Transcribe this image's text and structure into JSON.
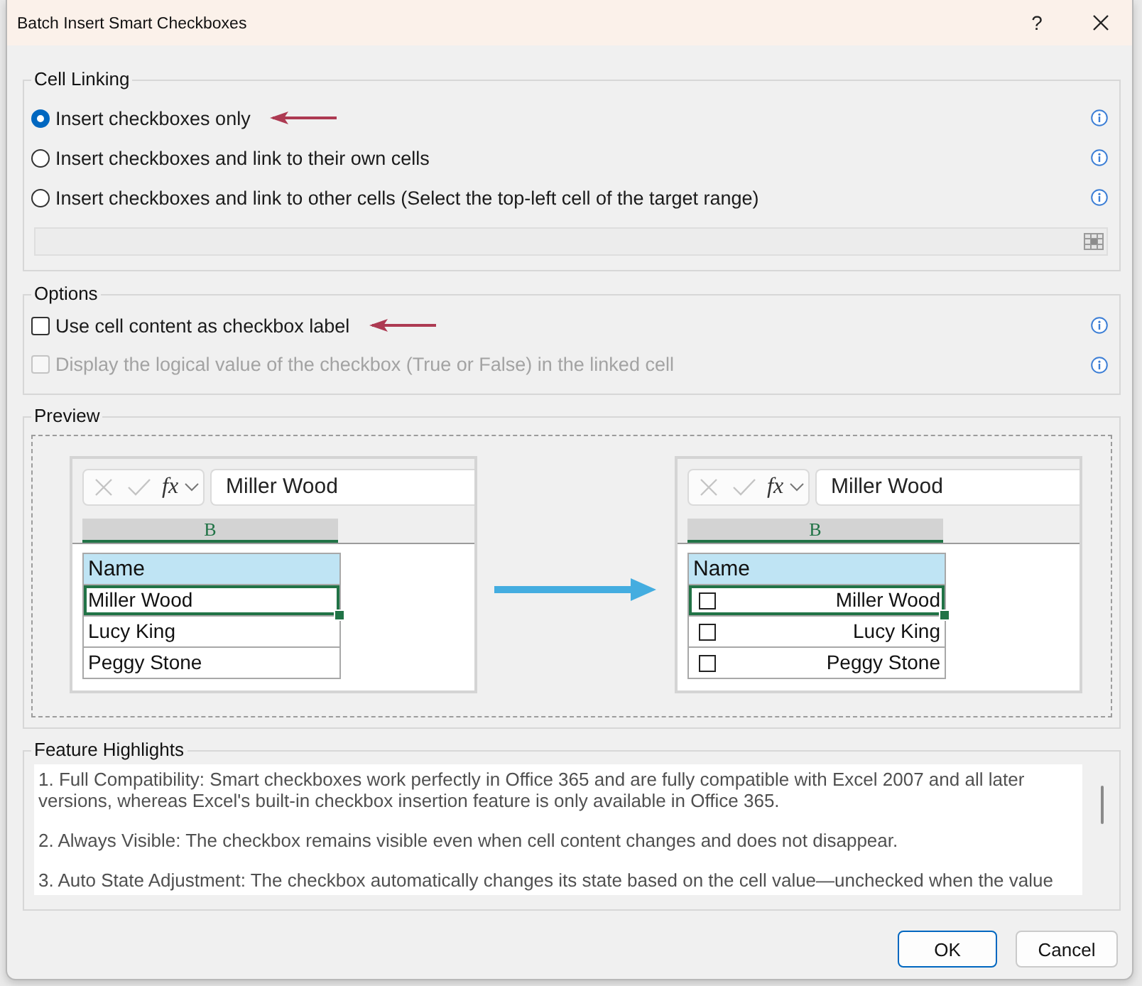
{
  "window": {
    "title": "Batch Insert Smart Checkboxes",
    "help_label": "?"
  },
  "cell_linking": {
    "title": "Cell Linking",
    "options": [
      {
        "label": "Insert checkboxes only",
        "selected": true,
        "marked": true
      },
      {
        "label": "Insert checkboxes and link to their own cells",
        "selected": false,
        "marked": false
      },
      {
        "label": "Insert checkboxes and link to other cells (Select the top-left cell of the target range)",
        "selected": false,
        "marked": false
      }
    ],
    "range_field": {
      "disabled": true
    }
  },
  "options": {
    "title": "Options",
    "items": [
      {
        "label": "Use cell content as checkbox label",
        "checked": false,
        "disabled": false,
        "marked": true
      },
      {
        "label": "Display the logical value of the checkbox (True or False) in the linked cell",
        "checked": false,
        "disabled": true,
        "marked": false
      }
    ]
  },
  "preview": {
    "title": "Preview",
    "sheets": [
      {
        "formula_value": "Miller Wood",
        "function_label": "fx",
        "column": "B",
        "cells": [
          {
            "kind": "header",
            "text": "Name",
            "selected": false
          },
          {
            "kind": "text",
            "text": "Miller Wood",
            "selected": true
          },
          {
            "kind": "text",
            "text": "Lucy King",
            "selected": false
          },
          {
            "kind": "text",
            "text": "Peggy Stone",
            "selected": false
          }
        ]
      },
      {
        "formula_value": "Miller Wood",
        "function_label": "fx",
        "column": "B",
        "cells": [
          {
            "kind": "header",
            "text": "Name",
            "selected": false
          },
          {
            "kind": "checkbox",
            "text": "Miller Wood",
            "checked": false,
            "selected": true
          },
          {
            "kind": "checkbox",
            "text": "Lucy King",
            "checked": false,
            "selected": false
          },
          {
            "kind": "checkbox",
            "text": "Peggy Stone",
            "checked": false,
            "selected": false
          }
        ]
      }
    ]
  },
  "feature_highlights": {
    "title": "Feature Highlights",
    "paragraphs": [
      "1. Full Compatibility: Smart checkboxes work perfectly in Office 365 and are fully compatible with Excel 2007 and all later versions, whereas Excel's built-in checkbox insertion feature is only available in Office 365.",
      "2. Always Visible: The checkbox remains visible even when cell content changes and does not disappear.",
      "3. Auto State Adjustment: The checkbox automatically changes its state based on the cell value—unchecked when the value"
    ]
  },
  "buttons": [
    {
      "label": "OK",
      "default": true
    },
    {
      "label": "Cancel",
      "default": false
    }
  ]
}
